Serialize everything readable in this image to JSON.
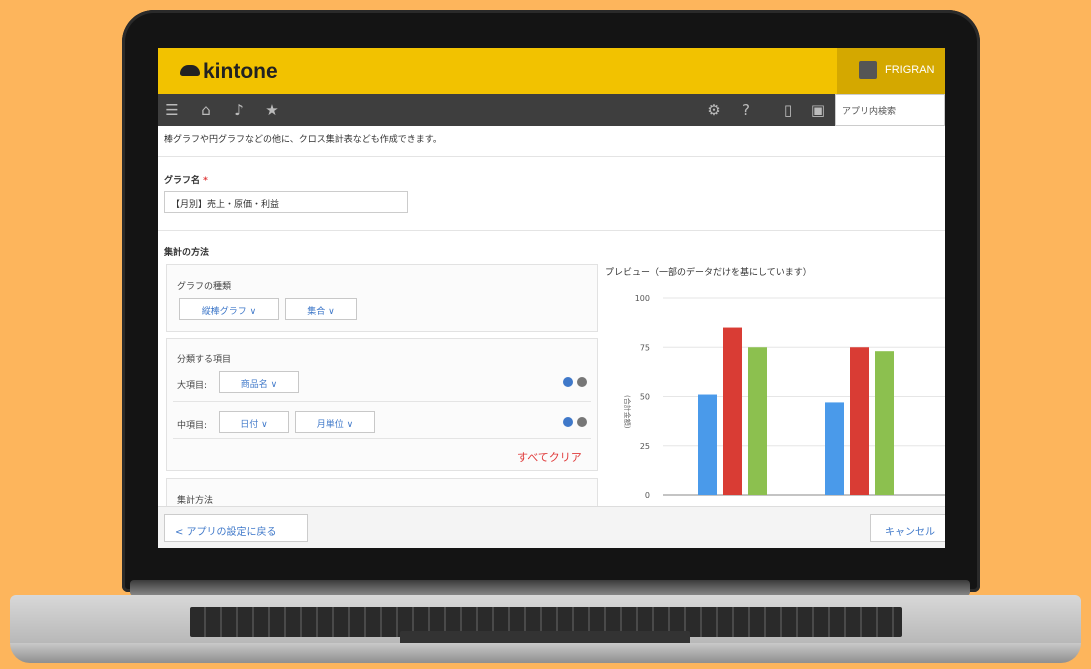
{
  "header": {
    "logo_text": "kintone",
    "user_name": "FRIGRAN"
  },
  "nav": {
    "icons": [
      "menu-icon",
      "home-icon",
      "bell-icon",
      "star-icon",
      "gear-icon",
      "help-icon",
      "mobile-icon",
      "app-icon"
    ],
    "search_placeholder": "アプリ内検索"
  },
  "description": "棒グラフや円グラフなどの他に、クロス集計表なども作成できます。",
  "graph_name": {
    "label": "グラフ名",
    "required_mark": "*",
    "value": "【月別】売上・原価・利益"
  },
  "aggregation": {
    "section_label": "集計の方法",
    "graph_type": {
      "label": "グラフの種類",
      "type_select": "縦棒グラフ ∨",
      "mode_select": "集合 ∨"
    },
    "classify": {
      "label": "分類する項目",
      "major_label": "大項目:",
      "major_select": "商品名 ∨",
      "middle_label": "中項目:",
      "middle_select": "日付 ∨",
      "middle_unit_select": "月単位 ∨",
      "clear_all": "すべてクリア"
    },
    "method_label": "集計方法"
  },
  "preview": {
    "title": "プレビュー（一部のデータだけを基にしています）"
  },
  "chart_data": {
    "type": "bar",
    "ylabel": "(合計金額)",
    "yticks": [
      "100",
      "75",
      "50",
      "25",
      "0"
    ],
    "ylim": [
      0,
      100
    ],
    "grid": true,
    "groups": [
      {
        "values": [
          51,
          85,
          75
        ]
      },
      {
        "values": [
          47,
          75,
          73
        ]
      }
    ],
    "colors": [
      "#4a9aea",
      "#d93c34",
      "#8cc04f"
    ]
  },
  "footer": {
    "back_label": "< アプリの設定に戻る",
    "cancel_label": "キャンセル"
  }
}
